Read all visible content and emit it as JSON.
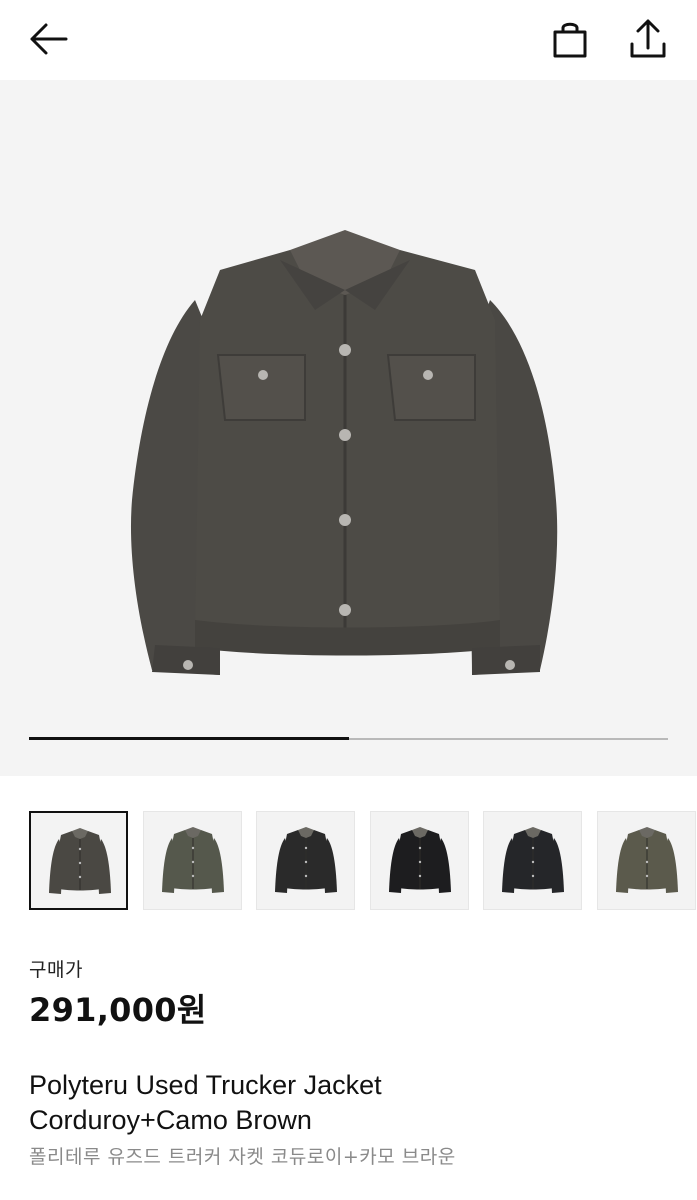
{
  "header": {
    "back_icon": "arrow-left-icon",
    "cart_icon": "shopping-bag-icon",
    "share_icon": "share-upload-icon"
  },
  "gallery": {
    "current_index": 1,
    "total_images": 2,
    "progress_fraction": 0.5,
    "thumbnails": [
      {
        "color": "#4a4843",
        "selected": true
      },
      {
        "color": "#55584c",
        "selected": false
      },
      {
        "color": "#2a2a2a",
        "selected": false
      },
      {
        "color": "#1d1d1f",
        "selected": false
      },
      {
        "color": "#252629",
        "selected": false
      },
      {
        "color": "#5b5a4c",
        "selected": false
      }
    ]
  },
  "product": {
    "price_label": "구매가",
    "price": "291,000원",
    "name_en_line1": "Polyteru Used Trucker Jacket",
    "name_en_line2": "Corduroy+Camo Brown",
    "name_ko": "폴리테루 유즈드 트러커 자켓 코듀로이+카모 브라운"
  },
  "colors": {
    "background": "#ffffff",
    "hero_background": "#f4f4f4",
    "text_primary": "#111111",
    "text_secondary": "#8a8a8a"
  }
}
